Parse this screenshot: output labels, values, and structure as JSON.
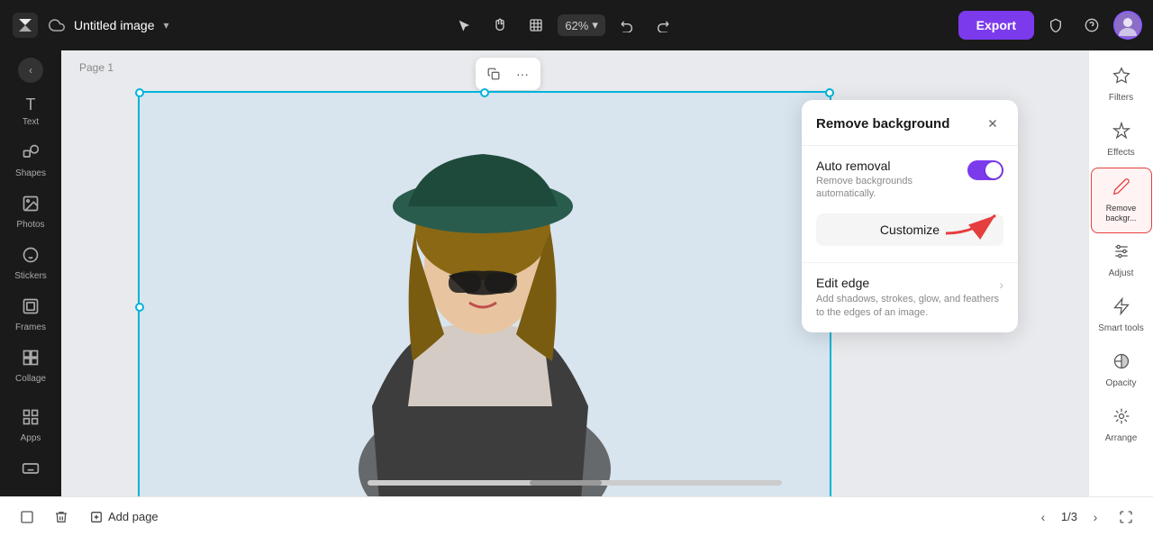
{
  "app": {
    "title": "Untitled image",
    "logo": "✕"
  },
  "topbar": {
    "title": "Untitled image",
    "zoom": "62%",
    "export_label": "Export",
    "tools": [
      "select",
      "hand",
      "frame",
      "zoom",
      "undo",
      "redo"
    ]
  },
  "left_sidebar": {
    "collapse_icon": "‹",
    "items": [
      {
        "id": "text",
        "icon": "T",
        "label": "Text"
      },
      {
        "id": "shapes",
        "icon": "◇",
        "label": "Shapes"
      },
      {
        "id": "photos",
        "icon": "🖼",
        "label": "Photos"
      },
      {
        "id": "stickers",
        "icon": "😊",
        "label": "Stickers"
      },
      {
        "id": "frames",
        "icon": "▣",
        "label": "Frames"
      },
      {
        "id": "collage",
        "icon": "⊞",
        "label": "Collage"
      },
      {
        "id": "apps",
        "icon": "⋯",
        "label": "Apps"
      }
    ]
  },
  "canvas": {
    "page_label": "Page 1",
    "toolbar": {
      "copy_icon": "⧉",
      "more_icon": "···"
    }
  },
  "remove_bg_panel": {
    "title": "Remove background",
    "close_icon": "✕",
    "auto_removal": {
      "label": "Auto removal",
      "description": "Remove backgrounds automatically.",
      "toggle_on": true
    },
    "customize_label": "Customize",
    "edit_edge": {
      "label": "Edit edge",
      "description": "Add shadows, strokes, glow, and feathers to the edges of an image."
    }
  },
  "right_sidebar": {
    "items": [
      {
        "id": "filters",
        "icon": "⧖",
        "label": "Filters"
      },
      {
        "id": "effects",
        "icon": "✦",
        "label": "Effects"
      },
      {
        "id": "remove-bg",
        "icon": "✏",
        "label": "Remove backgr...",
        "active": true
      },
      {
        "id": "adjust",
        "icon": "≡",
        "label": "Adjust"
      },
      {
        "id": "smart-tools",
        "icon": "⚡",
        "label": "Smart tools"
      },
      {
        "id": "opacity",
        "icon": "◎",
        "label": "Opacity"
      },
      {
        "id": "arrange",
        "icon": "⊡",
        "label": "Arrange"
      }
    ]
  },
  "bottom_bar": {
    "add_page_label": "Add page",
    "page_current": "1/3",
    "prev_icon": "‹",
    "next_icon": "›"
  }
}
